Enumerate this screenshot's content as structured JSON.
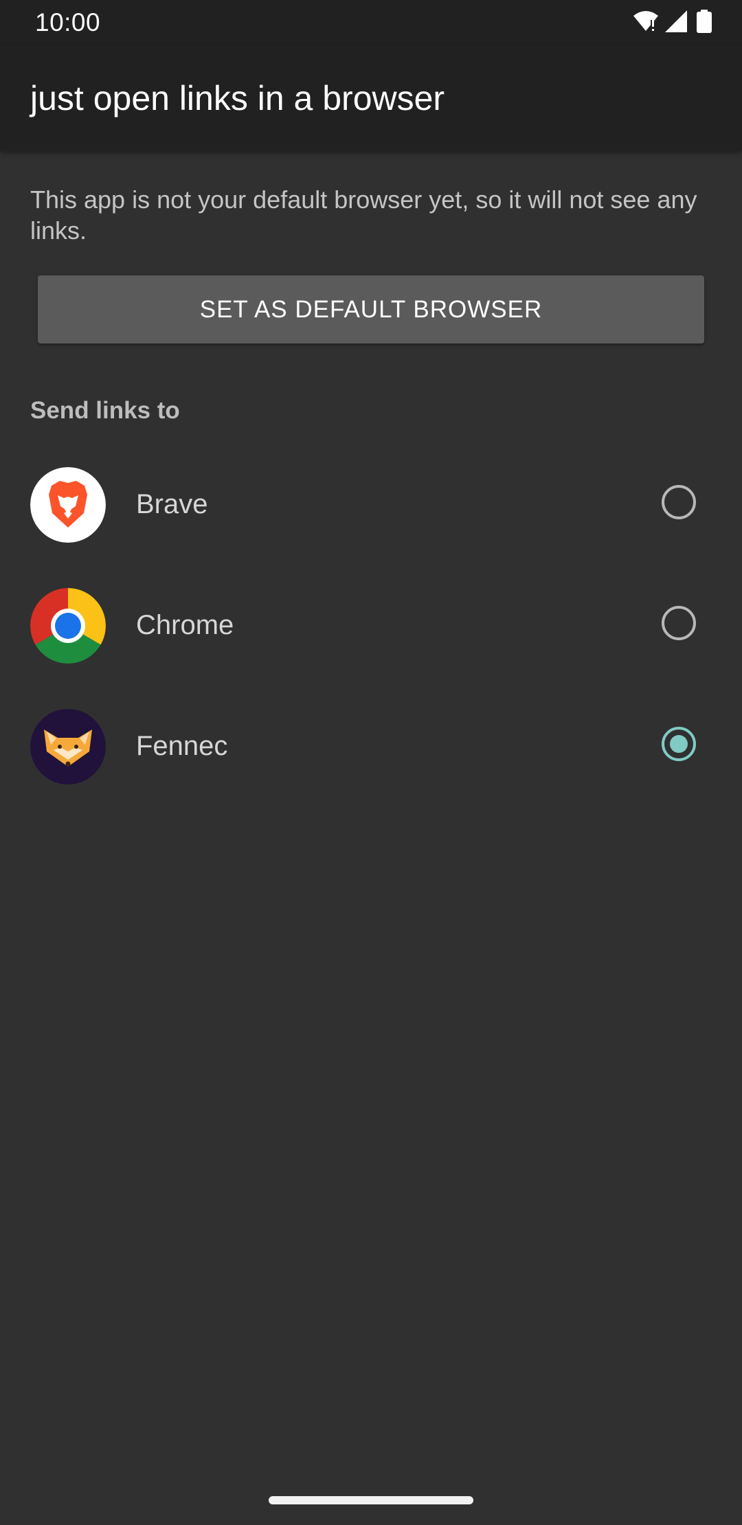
{
  "status_bar": {
    "time": "10:00",
    "icons": [
      "wifi-icon",
      "cell-signal-icon",
      "battery-icon"
    ]
  },
  "app_bar": {
    "title": "just open links in a browser"
  },
  "notice": {
    "text": "This app is not your default browser yet, so it will not see any links."
  },
  "default_button": {
    "label": "SET AS DEFAULT BROWSER"
  },
  "browsers": {
    "header": "Send links to",
    "items": [
      {
        "name": "Brave",
        "icon": "brave-logo-icon",
        "selected": false
      },
      {
        "name": "Chrome",
        "icon": "chrome-logo-icon",
        "selected": false
      },
      {
        "name": "Fennec",
        "icon": "fennec-logo-icon",
        "selected": true
      }
    ]
  },
  "colors": {
    "background": "#303030",
    "app_bar": "#212121",
    "button": "#5b5b5b",
    "accent": "#80cbc4"
  }
}
